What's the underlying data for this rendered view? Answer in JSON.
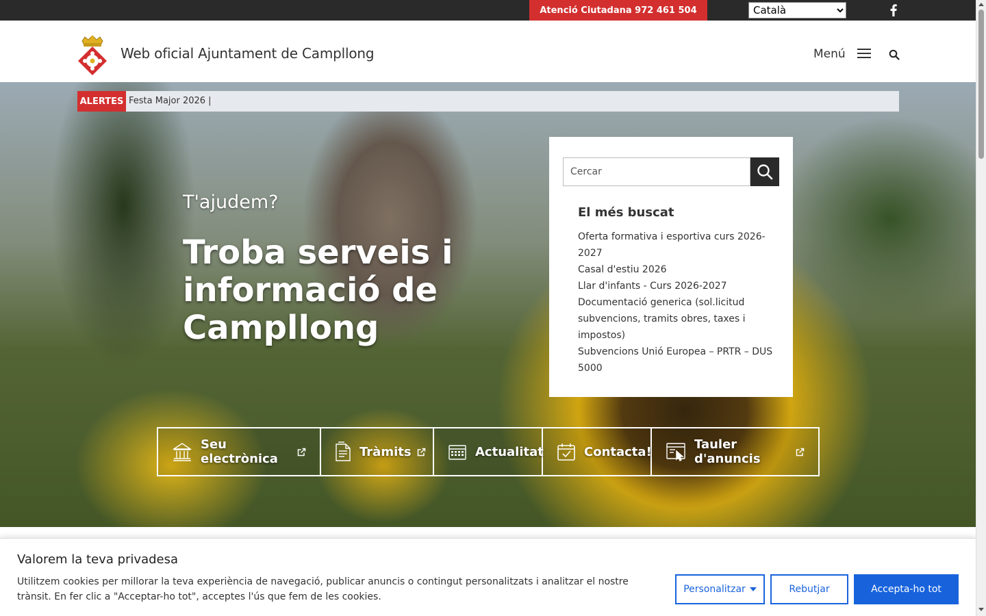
{
  "topbar": {
    "attention": "Atenció Ciutadana 972 461 504",
    "language_selected": "Català",
    "social_icon": "facebook-icon"
  },
  "header": {
    "site_title": "Web oficial Ajuntament de Campllong",
    "menu_label": "Menú",
    "logo_icon": "municipal-coat-of-arms",
    "menu_icon": "hamburger-icon",
    "search_icon": "search-icon"
  },
  "alerts": {
    "badge": "ALERTES",
    "text": "Festa Major 2026 |"
  },
  "hero": {
    "subtitle": "T'ajudem?",
    "title": "Troba serveis i informació de Campllong"
  },
  "search": {
    "placeholder": "Cercar",
    "popular_title": "El més buscat",
    "popular": [
      "Oferta formativa i esportiva curs 2026-2027",
      "Casal d'estiu 2026",
      "Llar d'infants - Curs 2026-2027",
      "Documentació generica (sol.licitud subvencions, tramits obres, taxes i impostos)",
      "Subvencions Unió Europea – PRTR – DUS 5000"
    ]
  },
  "quick_links": [
    {
      "label": "Seu electrònica",
      "icon": "building-icon",
      "external": true
    },
    {
      "label": "Tràmits",
      "icon": "document-icon",
      "external": true
    },
    {
      "label": "Actualitat",
      "icon": "calendar-icon",
      "external": false
    },
    {
      "label": "Contacta!",
      "icon": "calendar-check-icon",
      "external": false
    },
    {
      "label": "Tauler d'anuncis",
      "icon": "board-click-icon",
      "external": true
    }
  ],
  "cookie": {
    "title": "Valorem la teva privadesa",
    "text": "Utilitzem cookies per millorar la teva experiència de navegació, publicar anuncis o contingut personalitzats i analitzar el nostre trànsit. En fer clic a \"Acceptar-ho tot\", acceptes l'ús que fem de les cookies.",
    "customize": "Personalitzar",
    "reject": "Rebutjar",
    "accept": "Accepta-ho tot"
  },
  "colors": {
    "alert_red": "#d32f2f",
    "dark": "#2a2a2a",
    "cookie_blue": "#1863dc"
  }
}
